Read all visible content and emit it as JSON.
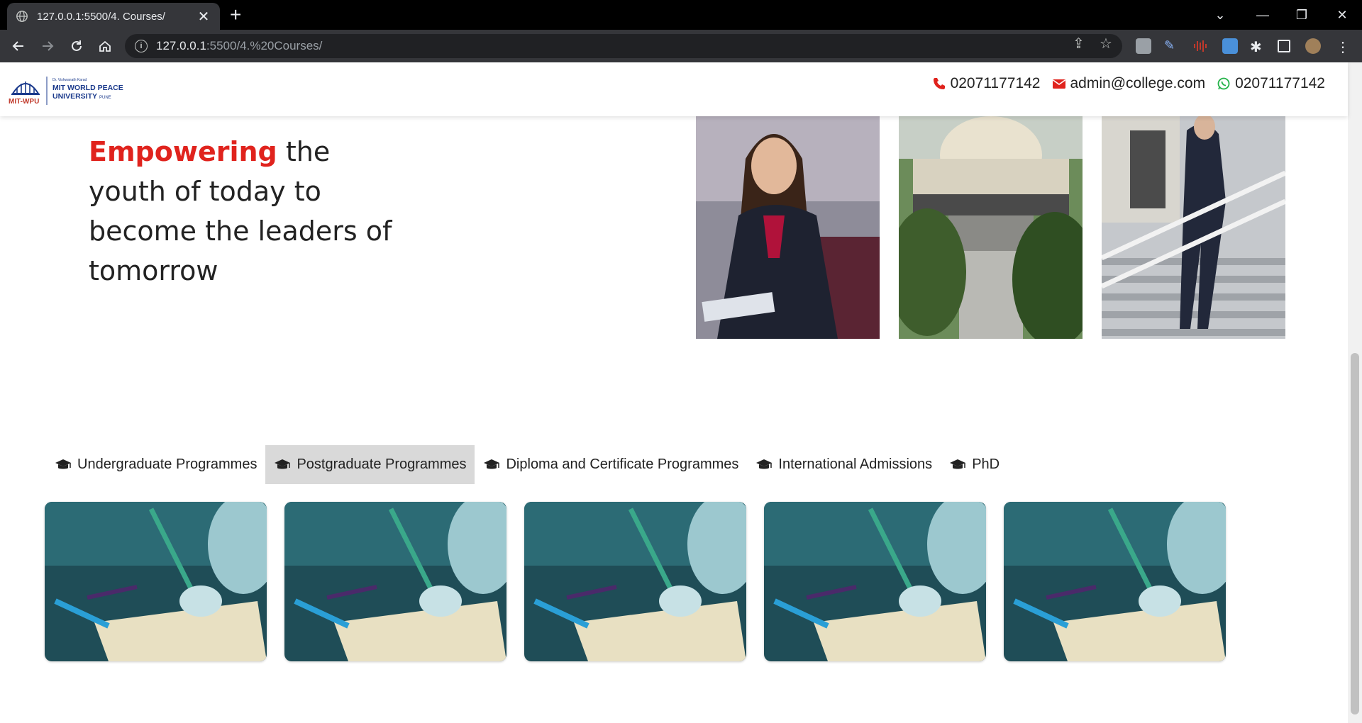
{
  "browser": {
    "tab_title": "127.0.0.1:5500/4. Courses/",
    "url_host": "127.0.0.1",
    "url_path": ":5500/4.%20Courses/"
  },
  "header": {
    "logo": {
      "brand_short": "MIT-WPU",
      "founder": "Dr. Vishwanath Karad",
      "name_line1": "MIT WORLD PEACE",
      "name_line2": "UNIVERSITY",
      "city": "PUNE"
    },
    "phone": "02071177142",
    "email": "admin@college.com",
    "whatsapp": "02071177142"
  },
  "hero": {
    "accent": "Empowering",
    "rest": " the youth of today to become the leaders of tomorrow"
  },
  "programme_tabs": [
    {
      "label": "Undergraduate Programmes",
      "active": false
    },
    {
      "label": "Postgraduate Programmes",
      "active": true
    },
    {
      "label": "Diploma and Certificate Programmes",
      "active": false
    },
    {
      "label": "International Admissions",
      "active": false
    },
    {
      "label": "PhD",
      "active": false
    }
  ],
  "colors": {
    "accent": "#e0231d",
    "active_tab_bg": "#d9d9d9",
    "logo_blue": "#1b3a8c"
  },
  "icons": {
    "phone": "phone-icon",
    "email": "envelope-icon",
    "whatsapp": "whatsapp-icon",
    "tab": "graduation-cap-icon"
  }
}
